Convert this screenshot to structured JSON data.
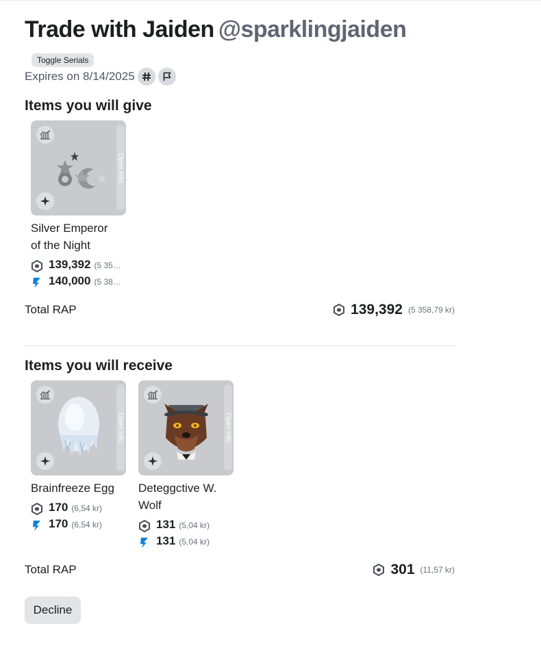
{
  "header": {
    "title": "Trade with Jaiden",
    "handle": "@sparklingjaiden",
    "toggle_serials": "Toggle Serials",
    "expires": "Expires on 8/14/2025"
  },
  "give": {
    "heading": "Items you will give",
    "items": [
      {
        "name_line1": "Silver Emperor",
        "name_line2": "of the Night",
        "rap": "139,392",
        "rap_local": "(5 35…",
        "value": "140,000",
        "value_local": "(5 38…",
        "open_info": "Open info"
      }
    ],
    "total_label": "Total RAP",
    "total_value": "139,392",
    "total_local": "(5 358,79 kr)"
  },
  "receive": {
    "heading": "Items you will receive",
    "items": [
      {
        "name_line1": "Brainfreeze Egg",
        "name_line2": "",
        "rap": "170",
        "rap_local": "(6,54 kr)",
        "value": "170",
        "value_local": "(6,54 kr)",
        "open_info": "Open info"
      },
      {
        "name_line1": "Deteggctive W.",
        "name_line2": "Wolf",
        "rap": "131",
        "rap_local": "(5,04 kr)",
        "value": "131",
        "value_local": "(5,04 kr)",
        "open_info": "Open info"
      }
    ],
    "total_label": "Total RAP",
    "total_value": "301",
    "total_local": "(11,57 kr)"
  },
  "actions": {
    "decline": "Decline"
  },
  "icons": {
    "hash": "hash-icon",
    "flag": "flag-icon",
    "chart": "chart-icon",
    "sparkle": "sparkle-icon",
    "robux": "robux-icon",
    "value": "value-icon"
  },
  "colors": {
    "value_icon": "#0f80d6",
    "card_bg": "#c9cacd"
  }
}
